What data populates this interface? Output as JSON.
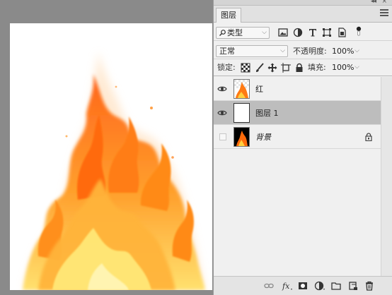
{
  "panel": {
    "tab_label": "图层",
    "filter": {
      "kind_label": "类型"
    },
    "blend_mode": "正常",
    "opacity_label": "不透明度:",
    "opacity_value": "100%",
    "lock_label": "锁定:",
    "fill_label": "填充:",
    "fill_value": "100%"
  },
  "layers": [
    {
      "name": "红",
      "visible": true,
      "selected": false,
      "italic": false,
      "locked": false
    },
    {
      "name": "图层 1",
      "visible": true,
      "selected": true,
      "italic": false,
      "locked": false
    },
    {
      "name": "背景",
      "visible": false,
      "selected": false,
      "italic": true,
      "locked": true
    }
  ],
  "colors": {
    "selected_row": "#bdbdbd",
    "panel_bg": "#f0f0f0",
    "workspace": "#8a8a8a",
    "flame_outer": "#ff7a14",
    "flame_mid": "#ffb52e",
    "flame_core": "#fff48a"
  },
  "icons": {
    "header": [
      "collapse-arrows-icon",
      "close-icon"
    ],
    "filter": [
      "image-filter-icon",
      "adjustment-filter-icon",
      "type-filter-icon",
      "shape-filter-icon",
      "smart-object-filter-icon",
      "filter-toggle-icon"
    ],
    "lock": [
      "lock-transparent-icon",
      "lock-pixels-icon",
      "lock-position-icon",
      "lock-artboard-icon",
      "lock-all-icon"
    ],
    "bottom": [
      "link-layers-icon",
      "fx-icon",
      "add-mask-icon",
      "new-adjustment-icon",
      "new-group-icon",
      "new-layer-icon",
      "delete-layer-icon"
    ]
  }
}
